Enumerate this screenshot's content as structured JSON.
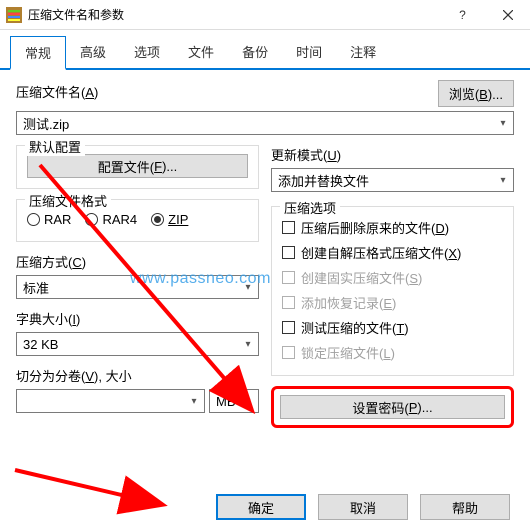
{
  "window": {
    "title": "压缩文件名和参数"
  },
  "tabs": {
    "general": "常规",
    "advanced": "高级",
    "options": "选项",
    "files": "文件",
    "backup": "备份",
    "time": "时间",
    "comment": "注释"
  },
  "archive": {
    "label_prefix": "压缩文件名(",
    "label_key": "A",
    "label_suffix": ")",
    "browse_prefix": "浏览(",
    "browse_key": "B",
    "browse_suffix": ")...",
    "value": "测试.zip"
  },
  "profile": {
    "legend": "默认配置",
    "button_prefix": "配置文件(",
    "button_key": "F",
    "button_suffix": ")..."
  },
  "update_mode": {
    "label_prefix": "更新模式(",
    "label_key": "U",
    "label_suffix": ")",
    "value": "添加并替换文件"
  },
  "format": {
    "legend": "压缩文件格式",
    "rar": "RAR",
    "rar4": "RAR4",
    "zip": "ZIP"
  },
  "method": {
    "label_prefix": "压缩方式(",
    "label_key": "C",
    "label_suffix": ")",
    "value": "标准"
  },
  "dict": {
    "label_prefix": "字典大小(",
    "label_key": "I",
    "label_suffix": ")",
    "value": "32 KB"
  },
  "split": {
    "label_prefix": "切分为分卷(",
    "label_key": "V",
    "label_suffix": "), 大小",
    "value": "",
    "unit": "MB"
  },
  "options": {
    "legend": "压缩选项",
    "delete_prefix": "压缩后删除原来的文件(",
    "delete_key": "D",
    "delete_suffix": ")",
    "sfx_prefix": "创建自解压格式压缩文件(",
    "sfx_key": "X",
    "sfx_suffix": ")",
    "solid_prefix": "创建固实压缩文件(",
    "solid_key": "S",
    "solid_suffix": ")",
    "recovery_prefix": "添加恢复记录(",
    "recovery_key": "E",
    "recovery_suffix": ")",
    "test_prefix": "测试压缩的文件(",
    "test_key": "T",
    "test_suffix": ")",
    "lock_prefix": "锁定压缩文件(",
    "lock_key": "L",
    "lock_suffix": ")"
  },
  "password": {
    "button_prefix": "设置密码(",
    "button_key": "P",
    "button_suffix": ")..."
  },
  "footer": {
    "ok": "确定",
    "cancel": "取消",
    "help": "帮助"
  },
  "watermark": "www.passneo.com"
}
